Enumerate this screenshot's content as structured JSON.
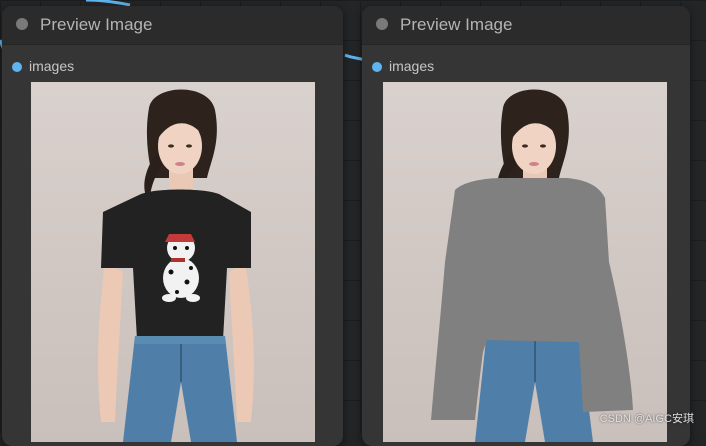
{
  "nodes": [
    {
      "title": "Preview Image",
      "slot": "images"
    },
    {
      "title": "Preview Image",
      "slot": "images"
    }
  ],
  "colors": {
    "link": "#5fb4f0",
    "mask_gray": "#808080",
    "shirt": "#222222",
    "jeans": "#4f7fa8"
  },
  "icons": [
    "collapse-dot-icon",
    "input-slot-icon"
  ],
  "watermark": "CSDN @AIGC安琪"
}
